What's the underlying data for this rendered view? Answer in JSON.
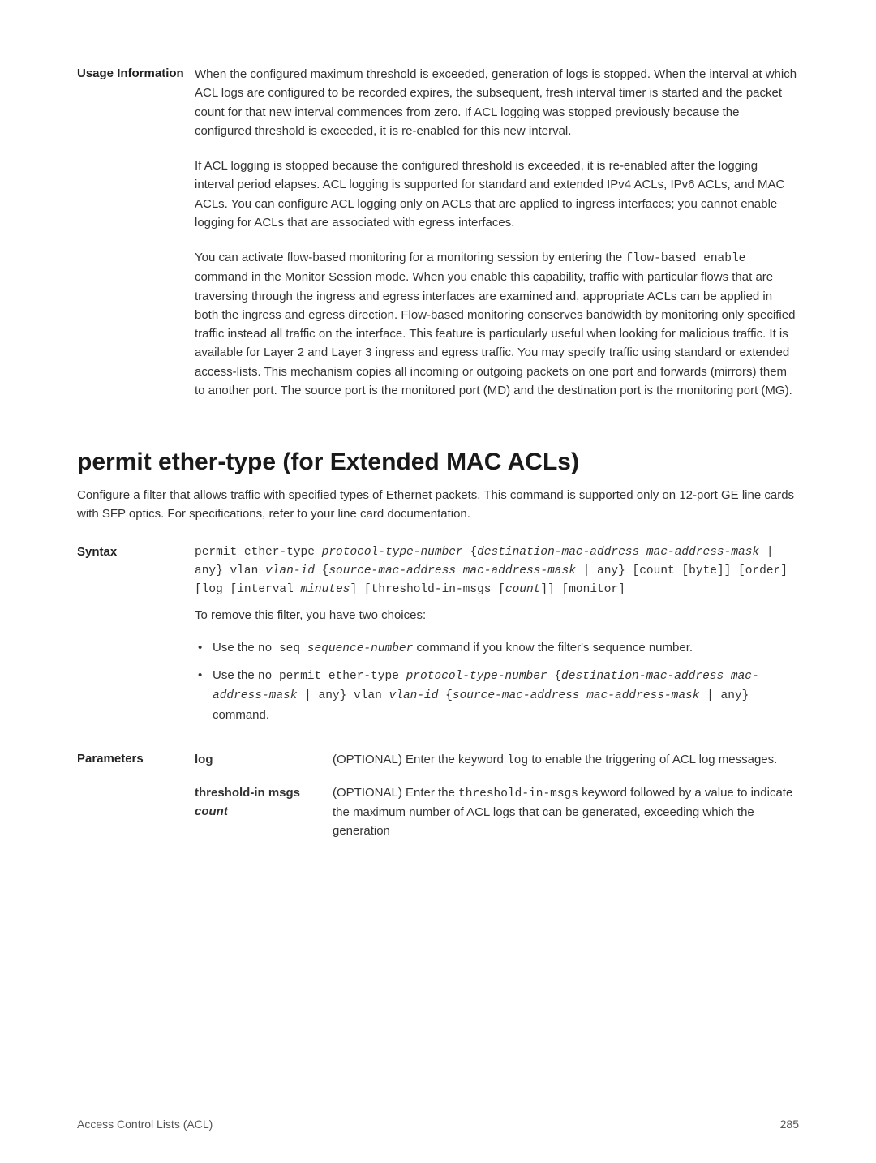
{
  "usage": {
    "label": "Usage Information",
    "para1": "When the configured maximum threshold is exceeded, generation of logs is stopped. When the interval at which ACL logs are configured to be recorded expires, the subsequent, fresh interval timer is started and the packet count for that new interval commences from zero. If ACL logging was stopped previously because the configured threshold is exceeded, it is re-enabled for this new interval.",
    "para2": "If ACL logging is stopped because the configured threshold is exceeded, it is re-enabled after the logging interval period elapses. ACL logging is supported for standard and extended IPv4 ACLs, IPv6 ACLs, and MAC ACLs. You can configure ACL logging only on ACLs that are applied to ingress interfaces; you cannot enable logging for ACLs that are associated with egress interfaces.",
    "para3a": "You can activate flow-based monitoring for a monitoring session by entering the ",
    "para3_code": "flow-based enable",
    "para3b": " command in the Monitor Session mode. When you enable this capability, traffic with particular flows that are traversing through the ingress and egress interfaces are examined and, appropriate ACLs can be applied in both the ingress and egress direction. Flow-based monitoring conserves bandwidth by monitoring only specified traffic instead all traffic on the interface. This feature is particularly useful when looking for malicious traffic. It is available for Layer 2 and Layer 3 ingress and egress traffic. You may specify traffic using standard or extended access-lists. This mechanism copies all incoming or outgoing packets on one port and forwards (mirrors) them to another port. The source port is the monitored port (MD) and the destination port is the monitoring port (MG)."
  },
  "heading": "permit ether-type (for Extended MAC ACLs)",
  "intro": "Configure a filter that allows traffic with specified types of Ethernet packets. This command is supported only on 12-port GE line cards with SFP optics. For specifications, refer to your line card documentation.",
  "syntax": {
    "label": "Syntax",
    "line1a": "permit ether-type ",
    "line1b": "protocol-type-number",
    "line1c": " {",
    "line1d": "destination-mac-address mac-address-mask",
    "line1e": " | any} vlan ",
    "line1f": "vlan-id",
    "line1g": " {",
    "line1h": "source-mac-address mac-address-mask",
    "line1i": " | any} [count [byte]] [order] [log [interval ",
    "line1j": "minutes",
    "line1k": "] [threshold-in-msgs [",
    "line1l": "count",
    "line1m": "]] [monitor]",
    "note": "To remove this filter, you have two choices:",
    "bullet1a": "Use the ",
    "bullet1b": "no seq ",
    "bullet1c": "sequence-number",
    "bullet1d": " command if you know the filter's sequence number.",
    "bullet2a": "Use the ",
    "bullet2b": "no permit ether-type ",
    "bullet2c": "protocol-type-number",
    "bullet2d": " {",
    "bullet2e": "destination-mac-address mac-address-mask",
    "bullet2f": " | any} vlan ",
    "bullet2g": "vlan-id",
    "bullet2h": " {",
    "bullet2i": "source-mac-address mac-address-mask",
    "bullet2j": " | any}",
    "bullet2k": " command."
  },
  "params": {
    "label": "Parameters",
    "p1_name": "log",
    "p1a": "(OPTIONAL) Enter the keyword ",
    "p1b": "log",
    "p1c": " to enable the triggering of ACL log messages.",
    "p2_name1": "threshold-in msgs ",
    "p2_name2": "count",
    "p2a": "(OPTIONAL) Enter the ",
    "p2b": "threshold-in-msgs",
    "p2c": " keyword followed by a value to indicate the maximum number of ACL logs that can be generated, exceeding which the generation"
  },
  "footer": {
    "left": "Access Control Lists (ACL)",
    "right": "285"
  }
}
